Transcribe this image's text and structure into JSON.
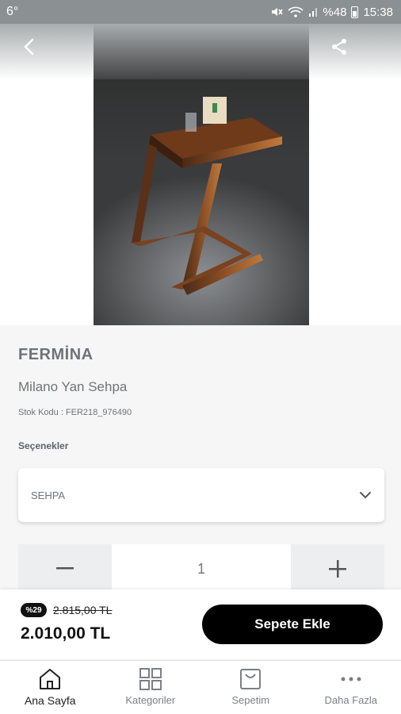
{
  "status_bar": {
    "temperature": "6°",
    "battery": "%48",
    "time": "15:38"
  },
  "header": {
    "back_icon": "chevron-left-icon",
    "share_icon": "share-icon"
  },
  "product": {
    "brand": "FERMİNA",
    "name": "Milano Yan Sehpa",
    "stock_label": "Stok Kodu : FER218_976490",
    "options_label": "Seçenekler",
    "selected_option": "SEHPA",
    "quantity": "1"
  },
  "price_bar": {
    "discount": "%29",
    "old_price": "2.815,00 TL",
    "new_price": "2.010,00 TL",
    "add_to_cart": "Sepete Ekle"
  },
  "bottom_nav": {
    "items": [
      {
        "label": "Ana Sayfa",
        "icon": "home-icon",
        "active": true
      },
      {
        "label": "Kategoriler",
        "icon": "grid-icon",
        "active": false
      },
      {
        "label": "Sepetim",
        "icon": "shopping-bag-icon",
        "active": false
      },
      {
        "label": "Daha Fazla",
        "icon": "more-icon",
        "active": false
      }
    ]
  },
  "colors": {
    "status_bar": "#8b9092",
    "accent": "#000000",
    "muted_text": "#6f7378"
  }
}
